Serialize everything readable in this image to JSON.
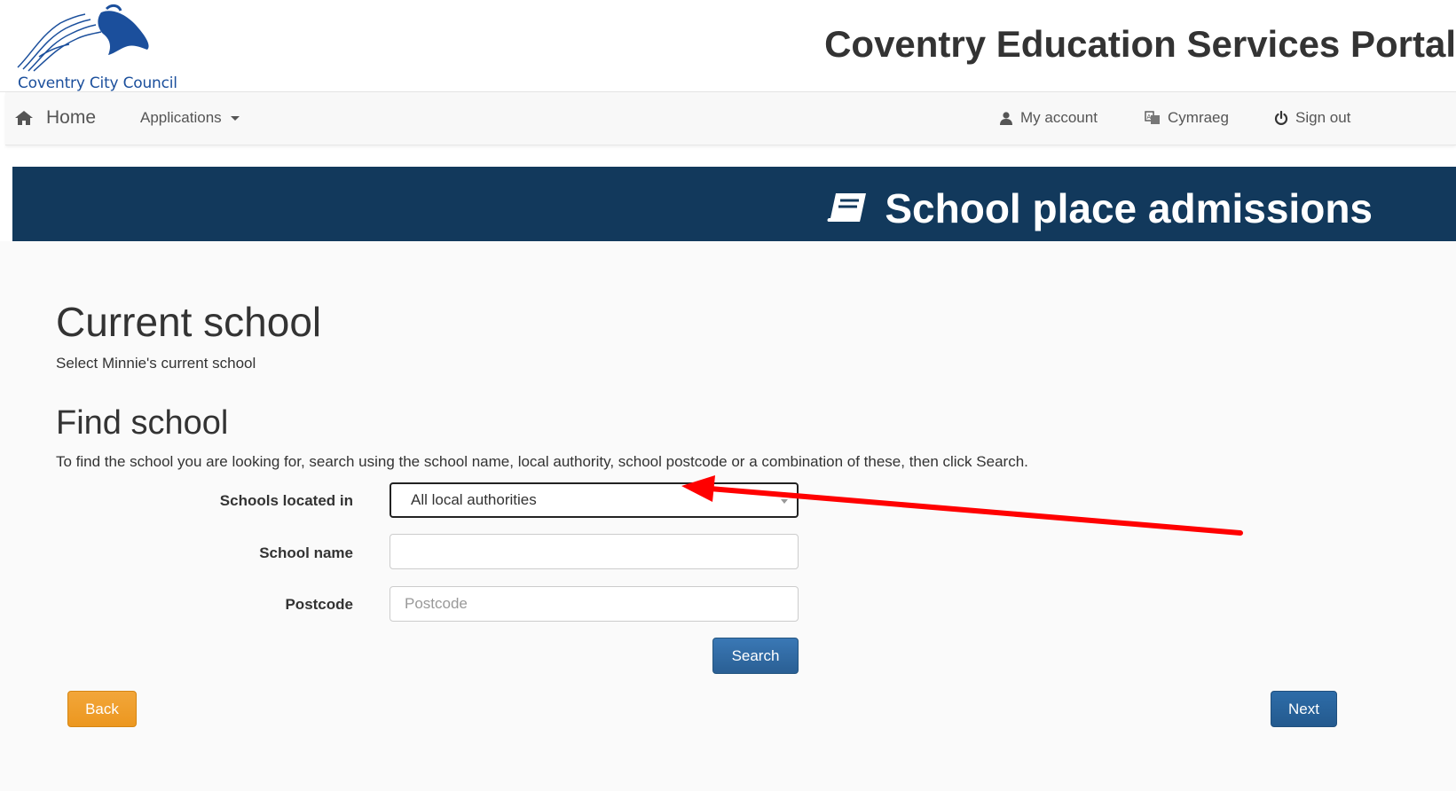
{
  "header": {
    "logo_text": "Coventry City Council",
    "portal_title": "Coventry Education Services Portal"
  },
  "nav": {
    "home_label": "Home",
    "applications_label": "Applications",
    "my_account_label": "My account",
    "cymraeg_label": "Cymraeg",
    "sign_out_label": "Sign out"
  },
  "banner": {
    "title": "School place admissions",
    "icon": "book-icon"
  },
  "page": {
    "heading": "Current school",
    "subheading": "Select Minnie's current school",
    "find_heading": "Find school",
    "help_text": "To find the school you are looking for, search using the school name, local authority, school postcode or a combination of these, then click Search."
  },
  "form": {
    "located_label": "Schools located in",
    "located_value": "All local authorities",
    "name_label": "School name",
    "name_value": "",
    "postcode_label": "Postcode",
    "postcode_placeholder": "Postcode",
    "search_button": "Search"
  },
  "footer_buttons": {
    "back": "Back",
    "next": "Next"
  },
  "colors": {
    "banner_bg": "#12395c",
    "primary_button": "#2a5f94",
    "warning_button": "#ec971f",
    "annotation_arrow": "#ff0000",
    "logo_blue": "#1b4f9c"
  }
}
